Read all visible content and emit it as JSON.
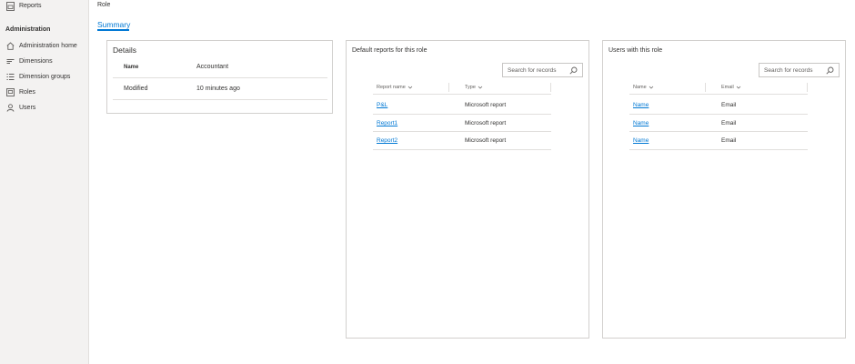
{
  "sidebar": {
    "reports_label": "Reports",
    "section_title": "Administration",
    "items": [
      {
        "label": "Administration home"
      },
      {
        "label": "Dimensions"
      },
      {
        "label": "Dimension groups"
      },
      {
        "label": "Roles"
      },
      {
        "label": "Users"
      }
    ]
  },
  "header": {
    "page_title": "Role",
    "tab_summary": "Summary"
  },
  "details": {
    "title": "Details",
    "name_label": "Name",
    "name_value": "Accountant",
    "modified_label": "Modified",
    "modified_value": "10 minutes ago"
  },
  "reports_panel": {
    "title": "Default reports for this role",
    "search_placeholder": "Search for records",
    "columns": [
      "Report name",
      "Type"
    ],
    "rows": [
      {
        "name": "P&L",
        "type": "Microsoft report"
      },
      {
        "name": "Report1",
        "type": "Microsoft report"
      },
      {
        "name": "Report2",
        "type": "Microsoft report"
      }
    ]
  },
  "users_panel": {
    "title": "Users with this role",
    "search_placeholder": "Search for records",
    "columns": [
      "Name",
      "Email"
    ],
    "rows": [
      {
        "name": "Name",
        "email": "Email"
      },
      {
        "name": "Name",
        "email": "Email"
      },
      {
        "name": "Name",
        "email": "Email"
      }
    ]
  }
}
